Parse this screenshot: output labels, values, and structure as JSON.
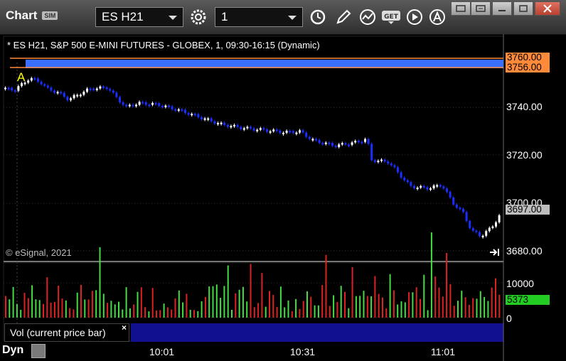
{
  "window": {
    "title": "Chart",
    "sim_badge": "SIM",
    "symbol": "ES H21",
    "interval": "1"
  },
  "chart": {
    "header": "* ES H21, S&P 500 E-MINI FUTURES - GLOBEX, 1, 09:30-16:15 (Dynamic)",
    "price_axis": [
      "3740.00",
      "3720.00",
      "3700.00",
      "3680.00"
    ],
    "band_labels": {
      "upper": "3760.00",
      "lower": "3756.00"
    },
    "last_price": "3697.00",
    "copyright": "© eSignal, 2021",
    "marker": "A",
    "time_axis": [
      "10:01",
      "10:31",
      "11:01"
    ],
    "colors": {
      "up": "#ffffff",
      "down": "#1a2fff",
      "band": "#3a6fff",
      "band_edge": "#ff8a3a"
    }
  },
  "volume": {
    "label": "Vol (current price bar)",
    "axis": [
      "10000",
      "0"
    ],
    "current": "5373",
    "colors": {
      "up": "#44dd44",
      "down": "#dd2222"
    }
  },
  "footer": {
    "mode": "Dyn"
  }
}
